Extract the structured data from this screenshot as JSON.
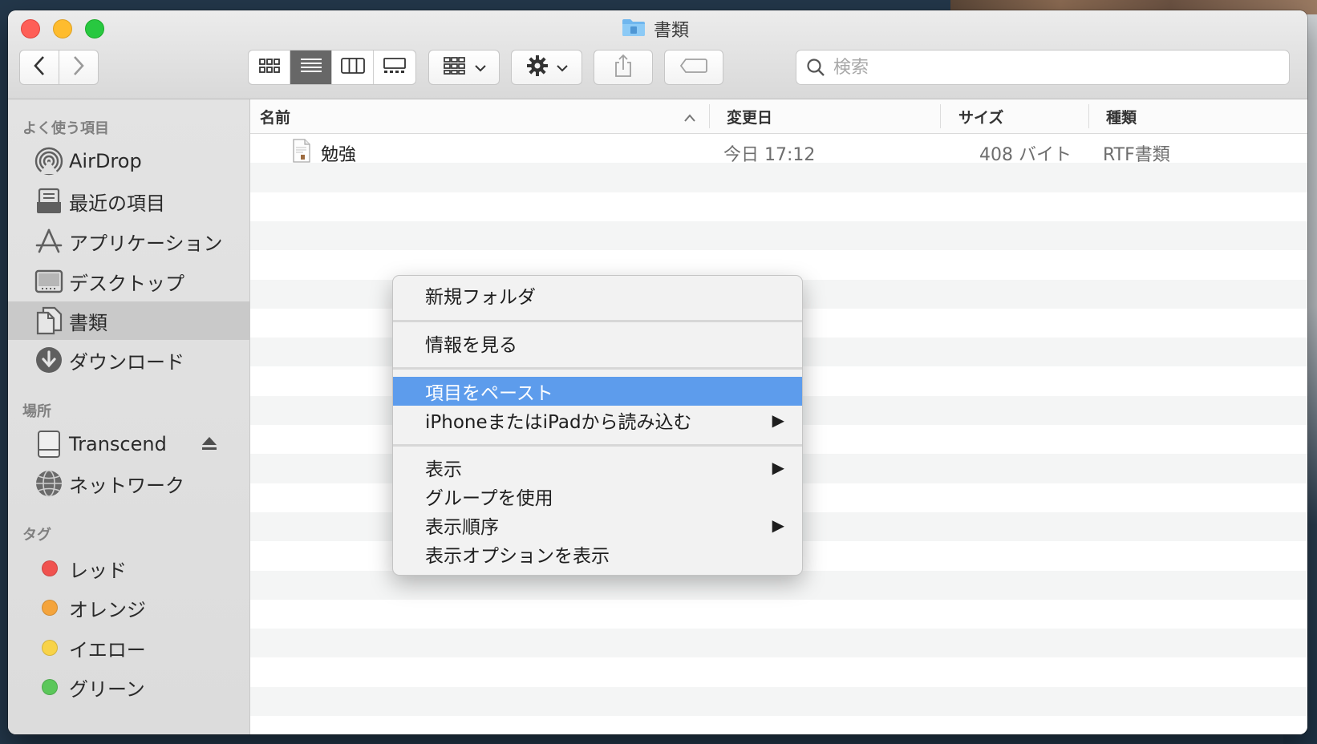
{
  "window": {
    "title": "書類"
  },
  "toolbar": {
    "back_icon": "chevron-left-icon",
    "forward_icon": "chevron-right-icon",
    "view_modes": [
      "icon-view-icon",
      "list-view-icon",
      "column-view-icon",
      "gallery-view-icon"
    ],
    "active_view": "list",
    "search_placeholder": "検索"
  },
  "sidebar": {
    "favorites_header": "よく使う項目",
    "favorites": [
      {
        "label": "AirDrop",
        "icon": "airdrop-icon"
      },
      {
        "label": "最近の項目",
        "icon": "recents-icon"
      },
      {
        "label": "アプリケーション",
        "icon": "applications-icon"
      },
      {
        "label": "デスクトップ",
        "icon": "desktop-icon"
      },
      {
        "label": "書類",
        "icon": "documents-icon",
        "selected": true
      },
      {
        "label": "ダウンロード",
        "icon": "downloads-icon"
      }
    ],
    "locations_header": "場所",
    "locations": [
      {
        "label": "Transcend",
        "icon": "drive-icon"
      },
      {
        "label": "ネットワーク",
        "icon": "network-icon"
      }
    ],
    "tags_header": "タグ",
    "tags": [
      {
        "label": "レッド",
        "color": "#f0524f"
      },
      {
        "label": "オレンジ",
        "color": "#f4a43c"
      },
      {
        "label": "イエロー",
        "color": "#f8d348"
      },
      {
        "label": "グリーン",
        "color": "#5bc75a"
      }
    ]
  },
  "table": {
    "columns": [
      "名前",
      "変更日",
      "サイズ",
      "種類"
    ],
    "rows": [
      {
        "name": "勉強",
        "modified": "今日 17:12",
        "size": "408 バイト",
        "kind": "RTF書類"
      }
    ]
  },
  "context_menu": {
    "items": [
      {
        "label": "新規フォルダ"
      },
      {
        "label": "情報を見る"
      },
      {
        "label": "項目をペースト",
        "highlighted": true
      },
      {
        "label": "iPhoneまたはiPadから読み込む",
        "submenu": true
      },
      {
        "label": "表示",
        "submenu": true
      },
      {
        "label": "グループを使用"
      },
      {
        "label": "表示順序",
        "submenu": true
      },
      {
        "label": "表示オプションを表示"
      }
    ],
    "submenu_glyph": "▶"
  },
  "colors": {
    "selection_blue": "#5d9cec",
    "sidebar_selected": "#c9c9c9"
  }
}
